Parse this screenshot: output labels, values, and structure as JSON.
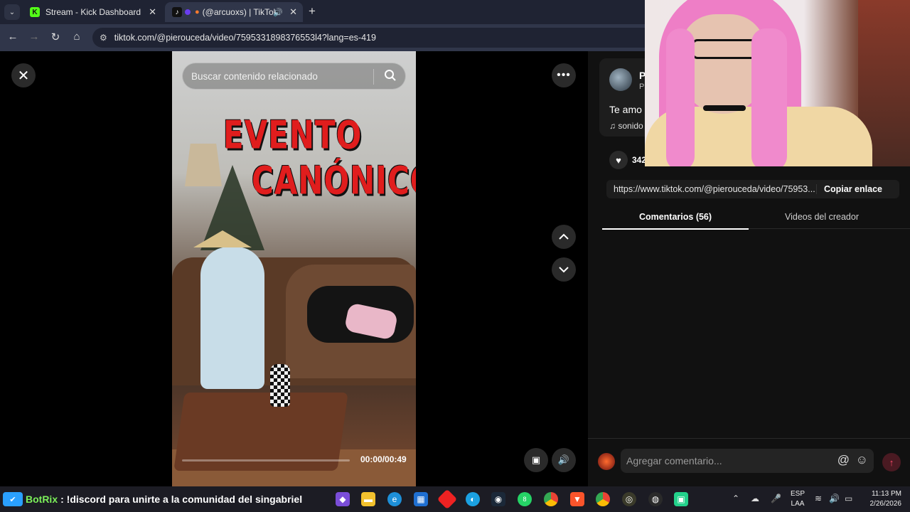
{
  "browser": {
    "tabs": [
      {
        "title": "Stream - Kick Dashboard",
        "active": false
      },
      {
        "title": "(@arcuoxs) | TikTok",
        "active": true
      }
    ],
    "url": "tiktok.com/@pierouceda/video/7595331898376553l4?lang=es-419"
  },
  "video": {
    "search_placeholder": "Buscar contenido relacionado",
    "overlay_title_line1": "EVENTO",
    "overlay_title_line2": "CANÓNICO",
    "timecode": "00:00/00:49",
    "progress": 0.0
  },
  "panel": {
    "creator_initial": "P",
    "creator_sub": "P",
    "caption": "Te amo r",
    "music": "sonido",
    "like_count": "342",
    "share_url": "https://www.tiktok.com/@pierouceda/video/75953...",
    "copy_link_label": "Copiar enlace",
    "tab_comments": "Comentarios (56)",
    "tab_videos": "Videos del creador",
    "comment_placeholder": "Agregar comentario..."
  },
  "taskbar": {
    "botrix_name": "BotRix",
    "botrix_message": ": !discord para unirte a la comunidad del singabriel",
    "lang_line1": "ESP",
    "lang_line2": "LAA",
    "time": "11:13 PM",
    "date": "2/26/2026",
    "whatsapp_badge": "8"
  },
  "colors": {
    "kick_green": "#53fc18",
    "tiktok_accent": "#fe2c55",
    "title_red": "#e01d1d"
  }
}
